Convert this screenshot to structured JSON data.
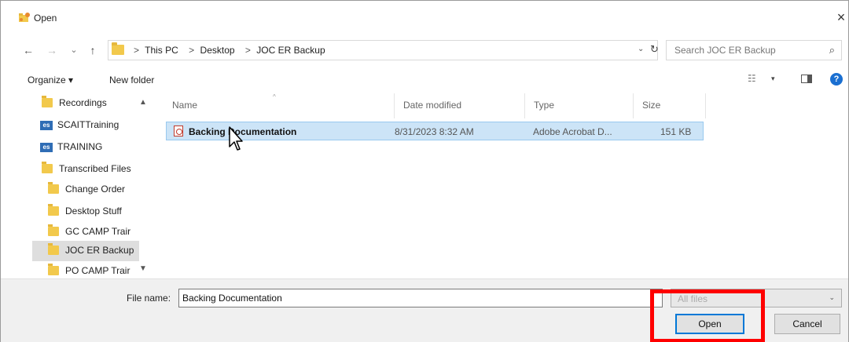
{
  "window": {
    "title": "Open",
    "close_glyph": "×"
  },
  "nav": {
    "back_glyph": "←",
    "forward_glyph": "→",
    "recent_glyph": "⌄",
    "up_glyph": "↑",
    "breadcrumbs": [
      "This PC",
      "Desktop",
      "JOC ER Backup"
    ],
    "separator": ">",
    "dropdown_glyph": "⌄",
    "refresh_glyph": "↻",
    "search_placeholder": "Search JOC ER Backup",
    "search_glyph": "⌕"
  },
  "toolbar": {
    "organize_label": "Organize ▾",
    "new_folder_label": "New folder",
    "view_glyph": "☷",
    "view_dropdown_glyph": "▾",
    "help_glyph": "?"
  },
  "sidebar": {
    "scroll_up": "▲",
    "scroll_down": "▼",
    "items": [
      {
        "label": "Recordings",
        "icon": "folder-icon"
      },
      {
        "label": "SCAITTraining",
        "icon": "es-app-icon",
        "icon_text": "es"
      },
      {
        "label": "TRAINING",
        "icon": "es-app-icon",
        "icon_text": "es"
      },
      {
        "label": "Transcribed Files",
        "icon": "folder-icon"
      },
      {
        "label": "Change Order",
        "icon": "folder-icon"
      },
      {
        "label": "Desktop Stuff",
        "icon": "folder-icon"
      },
      {
        "label": "GC CAMP Trair",
        "icon": "folder-icon"
      },
      {
        "label": "JOC ER Backup",
        "icon": "folder-icon",
        "selected": true
      },
      {
        "label": "PO CAMP Trair",
        "icon": "folder-icon"
      }
    ]
  },
  "filelist": {
    "sort_indicator": "^",
    "columns": [
      "Name",
      "Date modified",
      "Type",
      "Size"
    ],
    "rows": [
      {
        "name": "Backing Documentation",
        "date_modified": "8/31/2023 8:32 AM",
        "type": "Adobe Acrobat D...",
        "size": "151 KB",
        "icon": "pdf-icon",
        "selected": true
      }
    ]
  },
  "footer": {
    "file_name_label": "File name:",
    "file_name_value": "Backing Documentation",
    "file_type_value": "All files",
    "file_type_dropdown_glyph": "⌄",
    "open_label": "Open",
    "cancel_label": "Cancel"
  },
  "colors": {
    "selection_bg": "#cce4f7",
    "selection_border": "#99c9ef",
    "highlight_box": "#ff0000",
    "folder": "#f2c94c",
    "help_blue": "#1a6fd1"
  }
}
